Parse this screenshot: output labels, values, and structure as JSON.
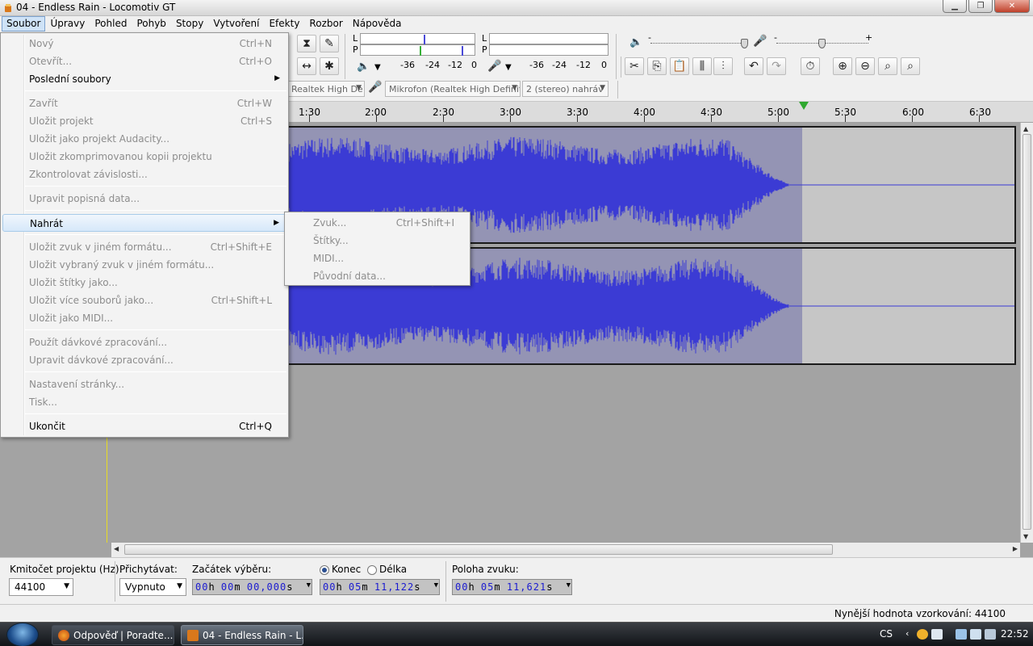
{
  "window": {
    "title": "04 - Endless Rain - Locomotiv GT"
  },
  "menubar": [
    "Soubor",
    "Úpravy",
    "Pohled",
    "Pohyb",
    "Stopy",
    "Vytvoření",
    "Efekty",
    "Rozbor",
    "Nápověda"
  ],
  "file_menu": {
    "items": [
      {
        "label": "Nový",
        "shortcut": "Ctrl+N"
      },
      {
        "label": "Otevřít...",
        "shortcut": "Ctrl+O"
      },
      {
        "label": "Poslední soubory",
        "shortcut": ""
      },
      {
        "label": "Zavřít",
        "shortcut": "Ctrl+W"
      },
      {
        "label": "Uložit projekt",
        "shortcut": "Ctrl+S"
      },
      {
        "label": "Uložit jako projekt Audacity...",
        "shortcut": ""
      },
      {
        "label": "Uložit zkomprimovanou kopii projektu",
        "shortcut": ""
      },
      {
        "label": "Zkontrolovat závislosti...",
        "shortcut": ""
      },
      {
        "label": "Upravit popisná data...",
        "shortcut": ""
      },
      {
        "label": "Nahrát",
        "shortcut": ""
      },
      {
        "label": "Uložit zvuk v jiném formátu...",
        "shortcut": "Ctrl+Shift+E"
      },
      {
        "label": "Uložit vybraný zvuk v jiném formátu...",
        "shortcut": ""
      },
      {
        "label": "Uložit štítky jako...",
        "shortcut": ""
      },
      {
        "label": "Uložit více souborů jako...",
        "shortcut": "Ctrl+Shift+L"
      },
      {
        "label": "Uložit jako MIDI...",
        "shortcut": ""
      },
      {
        "label": "Použít dávkové zpracování...",
        "shortcut": ""
      },
      {
        "label": "Upravit dávkové zpracování...",
        "shortcut": ""
      },
      {
        "label": "Nastavení stránky...",
        "shortcut": ""
      },
      {
        "label": "Tisk...",
        "shortcut": ""
      },
      {
        "label": "Ukončit",
        "shortcut": "Ctrl+Q"
      }
    ]
  },
  "import_submenu": {
    "items": [
      {
        "label": "Zvuk...",
        "shortcut": "Ctrl+Shift+I"
      },
      {
        "label": "Štítky...",
        "shortcut": ""
      },
      {
        "label": "MIDI...",
        "shortcut": ""
      },
      {
        "label": "Původní data...",
        "shortcut": ""
      }
    ]
  },
  "meters": {
    "channel_left": "L",
    "channel_right": "P",
    "scale": [
      "-36",
      "-24",
      "-12",
      "0"
    ]
  },
  "mixer": {
    "min": "-",
    "max": "+"
  },
  "devices": {
    "playback": "Realtek High De",
    "recording": "Mikrofon (Realtek High Definiti",
    "channels": "2 (stereo) nahráv"
  },
  "timeline": {
    "labels": [
      "1:30",
      "2:00",
      "2:30",
      "3:00",
      "3:30",
      "4:00",
      "4:30",
      "5:00",
      "5:30",
      "6:00",
      "6:30"
    ]
  },
  "selection_bar": {
    "rate_label": "Kmitočet projektu (Hz):",
    "rate_value": "44100",
    "snap_label": "Přichytávat:",
    "snap_value": "Vypnuto",
    "start_label": "Začátek výběru:",
    "start_value": {
      "h": "00",
      "m": "00",
      "s": "00,000"
    },
    "end_label": "Konec",
    "length_label": "Délka",
    "end_value": {
      "h": "00",
      "m": "05",
      "s": "11,122"
    },
    "pos_label": "Poloha zvuku:",
    "pos_value": {
      "h": "00",
      "m": "05",
      "s": "11,621"
    },
    "unit_h": "h",
    "unit_m": "m",
    "unit_s": "s"
  },
  "status": {
    "text": "Nynější hodnota vzorkování: 44100"
  },
  "taskbar": {
    "buttons": [
      "Odpověď | Poradte...",
      "04 - Endless Rain - L..."
    ],
    "lang": "CS",
    "clock": "22:52"
  },
  "colors": {
    "waveform": "#3b3bd4",
    "selection": "#9494b4",
    "playhead": "#2fa82f",
    "cursor": "#e8dc20"
  }
}
